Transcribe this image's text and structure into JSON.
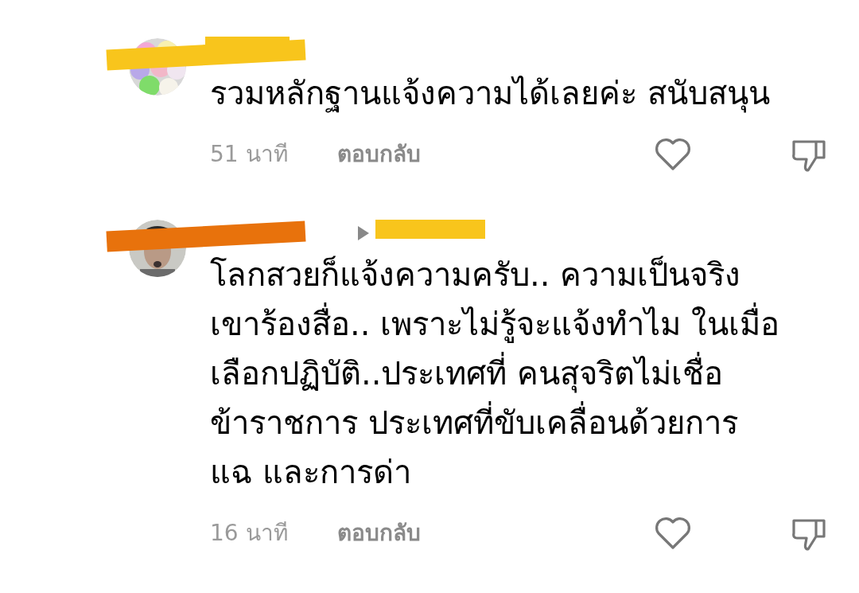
{
  "comments": [
    {
      "color": "#f8c51c",
      "reply_arrow": false,
      "text": "รวมหลักฐานแจ้งความได้เลยค่ะ สนับสนุน",
      "time": "51 นาที",
      "reply": "ตอบกลับ",
      "liked": false,
      "disliked": false
    },
    {
      "color": "#e8720c",
      "reply_arrow": true,
      "text": "โลกสวยก็แจ้งความครับ.. ความเป็นจริง\nเขาร้องสื่อ.. เพราะไม่รู้จะแจ้งทำไม ในเมื่อ\nเลือกปฏิบัติ..ประเทศที่ คนสุจริตไม่เชื่อ\nข้าราชการ ประเทศที่ขับเคลื่อนด้วยการ\nแฉ และการด่า",
      "time": "16 นาที",
      "reply": "ตอบกลับ",
      "liked": false,
      "disliked": false
    }
  ]
}
